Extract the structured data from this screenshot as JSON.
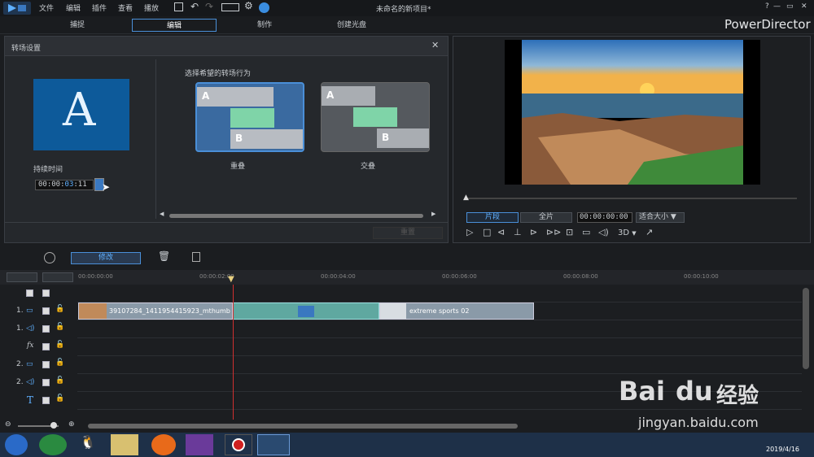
{
  "app": {
    "title": "未命名的新项目*",
    "brand": "PowerDirector",
    "help": "?",
    "win_min": "—",
    "win_max": "▭",
    "win_close": "✕"
  },
  "menu": [
    "文件",
    "编辑",
    "插件",
    "查看",
    "播放"
  ],
  "modes": [
    "捕捉",
    "编辑",
    "制作",
    "创建光盘"
  ],
  "dialog": {
    "title": "转场设置",
    "close": "✕",
    "duration_label": "持续时间",
    "duration": {
      "hh": "00",
      "mm": "00",
      "ss": "03",
      "ff": "11"
    },
    "behavior_label": "选择希望的转场行为",
    "options": [
      {
        "label": "重叠",
        "selected": true
      },
      {
        "label": "交叠",
        "selected": false
      }
    ],
    "thumb_letter": "A",
    "option_a": "A",
    "option_b": "B",
    "reset": "重置"
  },
  "preview": {
    "mode_clip": "片段",
    "mode_full": "全片",
    "timecode": "00:00:00:00",
    "fit": "适合大小",
    "fit_arrow": "▼",
    "three_d": "3D",
    "three_d_arrow": "▼"
  },
  "toolbar": {
    "modify": "修改"
  },
  "ruler": [
    "00:00:00:00",
    "00:00:02:00",
    "00:00:04:00",
    "00:00:06:00",
    "00:00:08:00",
    "00:00:10:00"
  ],
  "tracks": [
    {
      "num": "",
      "kind": "master"
    },
    {
      "num": "1.",
      "kind": "video"
    },
    {
      "num": "1.",
      "kind": "audio"
    },
    {
      "num": "",
      "kind": "fx",
      "label": "fx"
    },
    {
      "num": "2.",
      "kind": "video"
    },
    {
      "num": "2.",
      "kind": "audio"
    },
    {
      "num": "",
      "kind": "title",
      "label": "T"
    }
  ],
  "clips": {
    "clip1": "39107284_1411954415923_mthumb",
    "clip2": "extreme sports 02"
  },
  "taskbar": {
    "date": "2019/4/16"
  },
  "watermark": {
    "logo": "Bai",
    "paw": "du",
    "cn": "经验",
    "url": "jingyan.baidu.com"
  },
  "colors": {
    "accent": "#4a8fd8",
    "transition": "#7fd4a8"
  }
}
